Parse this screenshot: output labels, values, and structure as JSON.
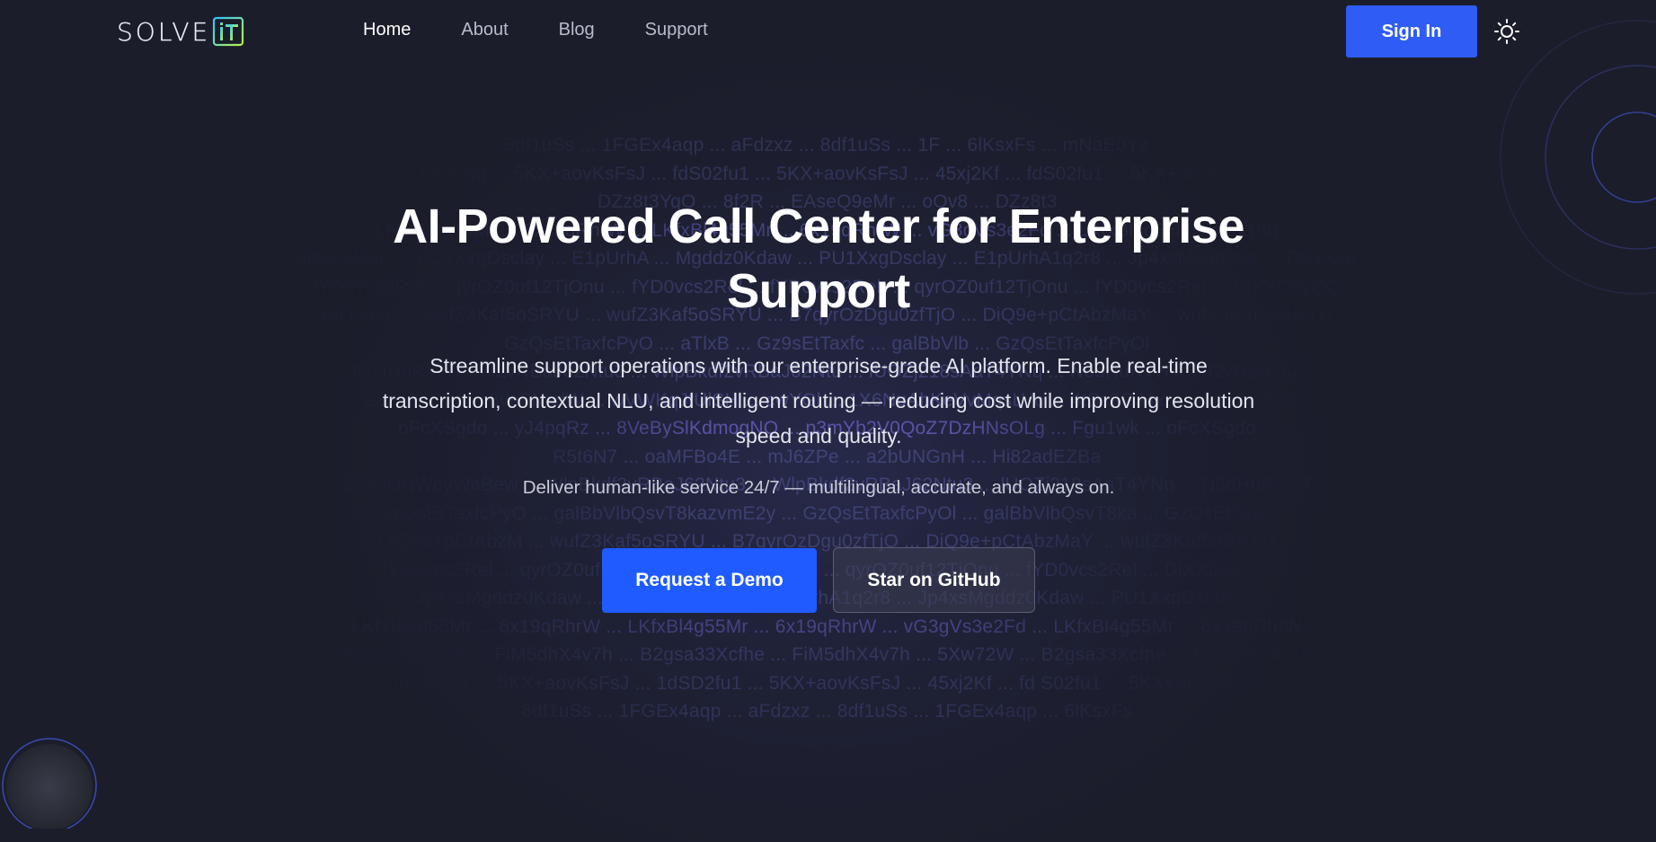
{
  "header": {
    "logo_text": "SOLVE",
    "logo_mark_text": "iT",
    "nav": [
      {
        "label": "Home",
        "active": true
      },
      {
        "label": "About",
        "active": false
      },
      {
        "label": "Blog",
        "active": false
      },
      {
        "label": "Support",
        "active": false
      }
    ],
    "sign_in_label": "Sign In",
    "theme_toggle_icon": "sun-icon"
  },
  "hero": {
    "title": "AI-Powered Call Center for Enterprise Support",
    "description": "Streamline support operations with our enterprise-grade AI platform. Enable real-time transcription, contextual NLU, and intelligent routing — reducing cost while improving resolution speed and quality.",
    "subtitle": "Deliver human-like service 24/7 — multilingual, accurate, and always on.",
    "primary_cta": "Request a Demo",
    "secondary_cta": "Star on GitHub"
  },
  "background_code": [
    "8df1uSs ... 1FGEx4aqp ... aFdzxz ... 8df1uSs ... 1F ... 6lKsxFs ... mNaE0Yz",
    "1Nr4Cgq ... 5KX+aovKsFsJ ... fdS02fu1 ... 5KX+aovKsFsJ ... 45xj2Kf ... fdS02fu1 ... 5KX+aovKsF",
    "DZz8t3YqO ... 8f2R ... EAseQ9eMr ... oOv8 ... DZz8t3",
    "LKfxBl4g55Mr ... 6x19qRhrW ... LKfxBl4g55Mr ... 6x19qRhrW ... vG3gVs3e2Fd ... LKfxBl4g55Mr ... 6x19q",
    "4lsxFsMgd ... PU1XxgDsclay ... E1pUrhA ... Mgddz0Kdaw ... PU1XxgDsclay ... E1pUrhA1q2r8 ... Jp4xsMgddz0K ... PU1Xxg",
    "fYD0vcs2Rel ... qyrOZ0uf12TjOnu ... fYD0vcs2Rel ... fYD0vcs2Reh ... qyrOZ0uf12TjOnu ... fYD0vcs2Rel ... DiXXDoyQQ",
    "DiQ9e+p ... wufZ3Kaf5oSRYU ... wufZ3Kaf5oSRYU ... B7qyrOzDgu0zfTjO ... DiQ9e+pCtAbzMaY ... wufZ3Kaf5oSRYU",
    "GzQsEtTaxfcPyO ... aTlxB ... Gz9sEtTaxfc ... galBbVlb ... GzQsEtTaxfcPyOl",
    "N6dHuRYHT ... f2vRBaJ62Ntu3 ... WlpBkdf2vRBaJ62Ntu ... lUOZj218sAaT4YNq ... N6dHuRYHT ... f2vRBaJ62",
    "e3ap2ptXw ... 6veFNsdW ... wVWKqJfUlSH ... cwYGl ... 1X6NuAhKeVvMqsLVc ... 4tSs9GJ4x ... e3ap2ptXw",
    "oFcXSgdo ... yJ4pqRz ... 8VeBySlKdmogNQ ... p3mYb2V0QoZ7DzHNsOLg ... Fgu1wk ... oFcXSgdo",
    "R5t6N7 ... oaMFBo4E ... mJ6ZPe ... a2bUNGnH ... Hi82adEZBa",
    "1HAzUNWeyWaBew ... WlpBkdf2vRBaJ62Ntu3 ... WlpBkdf2vRBaJ62Ntu3 ... lUOZj218sAaT4YNq ... N6dHuRYHT",
    "GzQsEtTaxfcPyO ... galBbVlbQsvT8kazvmE2y ... GzQsEtTaxfcPyOl ... galBbVlbQsvT8ka ... GzQsEtTaxfc",
    "DiQ9e+pCtAbzM ... wufZ3Kaf5oSRYU ... B7qyrOzDgu0zfTjO ... DiQ9e+pCtAbzMaY ... wufZ3Kaf5oSRYU",
    "fYD0vcs2Rel ... qyrOZ0uf12TjOnu ... fYD0vcs2Reh ... qyrOZ0uf12TjOnu ... fYD0vcs2Rel ... DiXXDoyQQ",
    "Jp4xsMgddz0Kdaw ... PU1XxgDsclay ... E1pUrhA1q2r8 ... Jp4xsMgddz0Kdaw ... PU1XxgDsclay",
    "LKfxBl4g55Mr ... 6x19qRhrW ... LKfxBl4g55Mr ... 6x19qRhrW ... vG3gVs3e2Fd ... LKfxBl4g55Mr ... 6x19qRhrW",
    "B2gsa33Xcfhe ... FiM5dhX4v7h ... B2gsa33Xcfhe ... FiM5dhX4v7h ... 5Xw72W ... B2gsa33Xcfhe ... FiM5dhX4v7h",
    "fdS02fu1 ... 5KX+aovKsFsJ ... 1dSD2fu1 ... 5KX+aovKsFsJ ... 45xj2Kf ... fd S02fu1 ... 5KX+aovKsFsJ",
    "8df1uSs ... 1FGEx4aqp ... aFdzxz ... 8df1uSs ... 1FGEx4aqp ... 6lKsxFs"
  ],
  "colors": {
    "background": "#1b1d2b",
    "primary": "#1f5bff",
    "sign_in": "#2f5cf5",
    "code_text": "#4a4f8a",
    "code_highlight": "#6a63c9",
    "logo_gradient_start": "#2ec5ff",
    "logo_gradient_end": "#b8f24a"
  }
}
